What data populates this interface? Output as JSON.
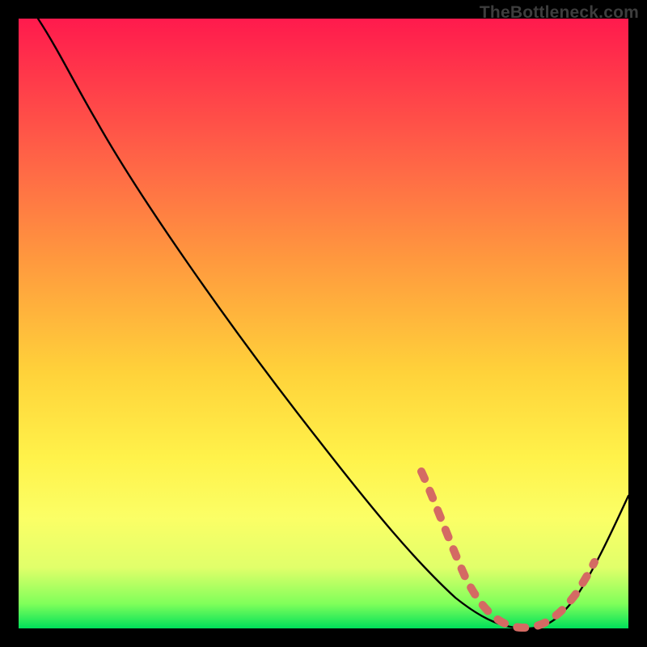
{
  "watermark": "TheBottleneck.com",
  "chart_data": {
    "type": "line",
    "title": "",
    "xlabel": "",
    "ylabel": "",
    "xlim": [
      0,
      100
    ],
    "ylim": [
      0,
      100
    ],
    "series": [
      {
        "name": "bottleneck-curve",
        "x": [
          0,
          3,
          8,
          15,
          25,
          35,
          45,
          55,
          62,
          66,
          70,
          74,
          78,
          82,
          86,
          90,
          95,
          100
        ],
        "values": [
          100,
          97,
          93,
          87,
          76,
          64,
          52,
          40,
          31,
          25,
          18,
          10,
          3,
          0,
          0,
          3,
          12,
          25
        ]
      }
    ],
    "markers": {
      "name": "dashed-segment-points",
      "x": [
        66,
        68,
        70,
        73,
        76,
        79,
        82,
        85,
        88,
        90,
        92
      ],
      "values": [
        25,
        19,
        13,
        7,
        3,
        1,
        0,
        0,
        1,
        4,
        9
      ],
      "color": "#d46a63"
    },
    "gradient_stops": [
      {
        "pos": 0,
        "color": "#ff1a4d"
      },
      {
        "pos": 25,
        "color": "#ff6a46"
      },
      {
        "pos": 58,
        "color": "#ffd23a"
      },
      {
        "pos": 82,
        "color": "#fbff66"
      },
      {
        "pos": 100,
        "color": "#00e05a"
      }
    ]
  }
}
